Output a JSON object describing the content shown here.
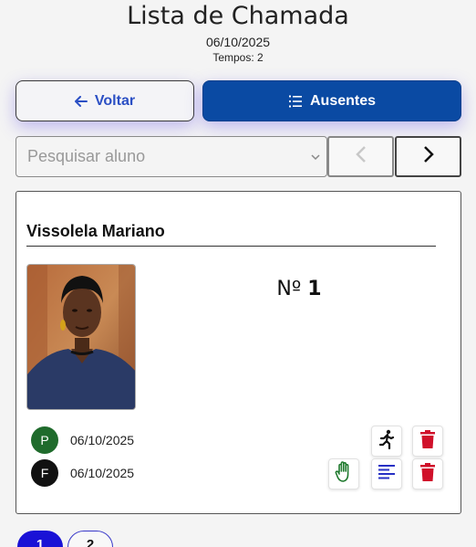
{
  "header": {
    "title": "Lista de Chamada",
    "date": "06/10/2025",
    "tempos": "Tempos: 2"
  },
  "buttons": {
    "voltar_label": "Voltar",
    "ausentes_label": "Ausentes"
  },
  "search": {
    "placeholder": "Pesquisar aluno"
  },
  "student": {
    "name": "Vissolela Mariano",
    "number_prefix": "Nº",
    "number": "1",
    "attendance": [
      {
        "badge": "P",
        "date": "06/10/2025"
      },
      {
        "badge": "F",
        "date": "06/10/2025"
      }
    ]
  },
  "pagination": {
    "pages": [
      "1",
      "2"
    ],
    "current": "1"
  },
  "colors": {
    "primary": "#0a4aa3",
    "present": "#1f6b2c",
    "absent": "#111111",
    "delete": "#d0102a",
    "justify": "#1f7a2e",
    "notes": "#2730c4",
    "page_active": "#1a12d6"
  },
  "icons": {
    "back": "arrow-left-icon",
    "list": "list-numbered-icon",
    "select": "chevron-down-icon",
    "prev": "chevron-left-icon",
    "next": "chevron-right-icon",
    "exit": "running-person-icon",
    "delete": "trash-icon",
    "justify": "hand-icon",
    "notes": "align-left-icon"
  }
}
